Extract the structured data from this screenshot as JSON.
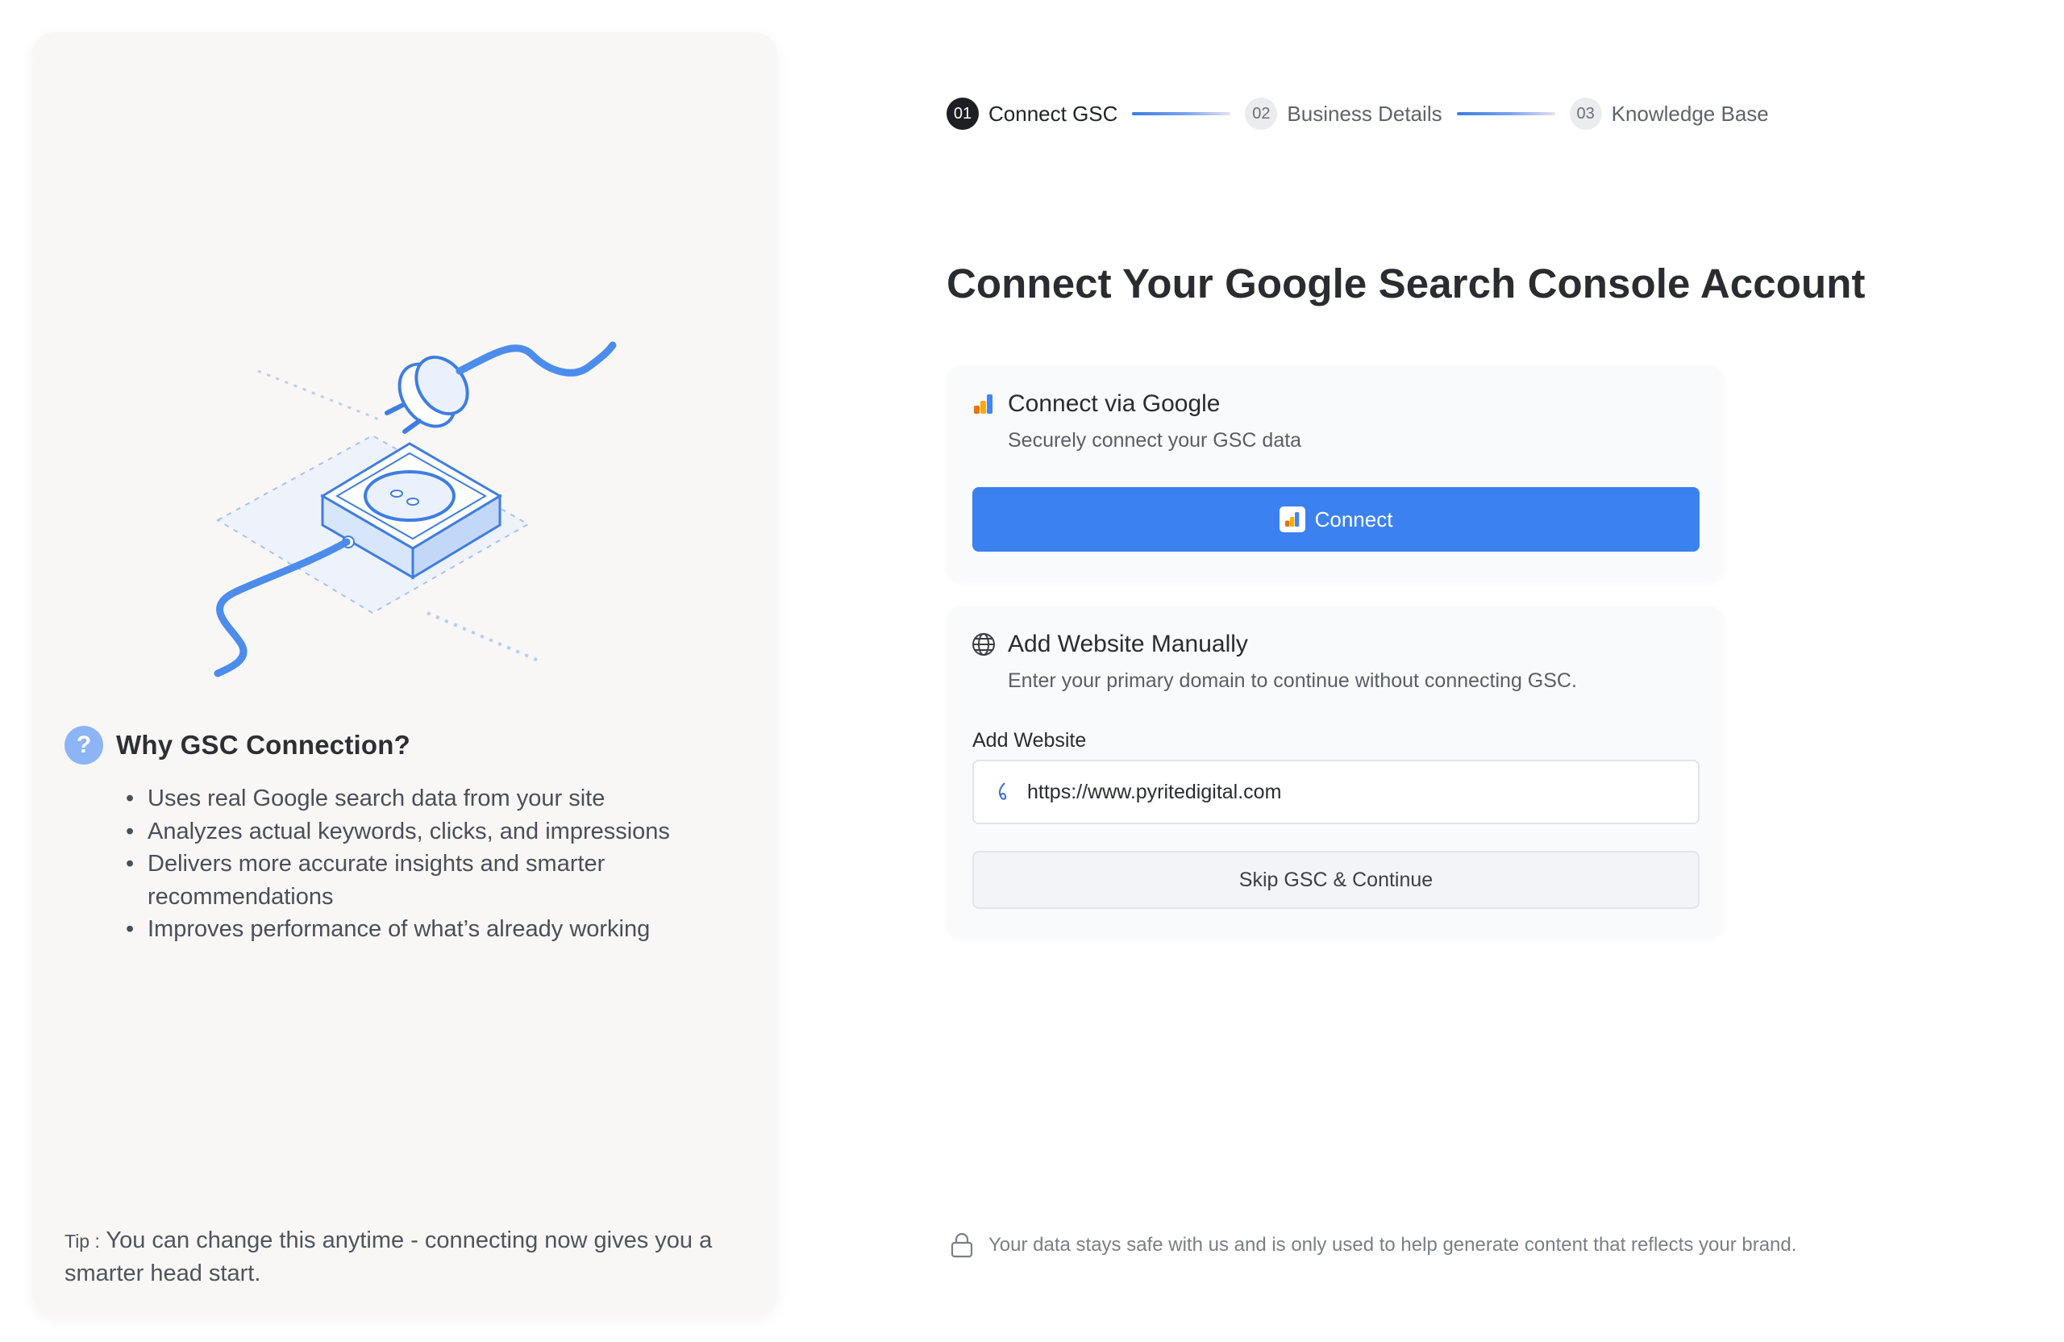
{
  "stepper": {
    "steps": [
      {
        "num": "01",
        "label": "Connect GSC",
        "state": "active"
      },
      {
        "num": "02",
        "label": "Business Details",
        "state": "inactive"
      },
      {
        "num": "03",
        "label": "Knowledge Base",
        "state": "inactive"
      }
    ]
  },
  "main": {
    "title": "Connect Your Google Search Console Account"
  },
  "google_card": {
    "icon": "analytics-icon",
    "title": "Connect via Google",
    "subtitle": "Securely connect your GSC data",
    "button_label": "Connect"
  },
  "manual_card": {
    "icon": "globe-icon",
    "title": "Add Website Manually",
    "subtitle": "Enter your primary domain to continue without connecting GSC.",
    "field_label": "Add Website",
    "field_value": "https://www.pyritedigital.com",
    "skip_label": "Skip GSC & Continue"
  },
  "sidebar": {
    "illustration": "plug-socket-illustration",
    "why_title": "Why GSC Connection?",
    "why_items": [
      "Uses real Google search data from your site",
      "Analyzes actual keywords, clicks, and impressions",
      "Delivers more accurate insights and smarter recommendations",
      "Improves performance of what’s already working"
    ],
    "tip_label": "Tip :",
    "tip_text": " You can change this anytime - connecting now gives you a smarter head start."
  },
  "footer": {
    "note": "Your data stays safe with us and is only used to help generate content that reflects your brand."
  },
  "colors": {
    "accent": "#3b82f0",
    "panel_bg": "#f8f7f6",
    "card_bg": "#f9fafc",
    "question_badge": "#8db4f4"
  }
}
